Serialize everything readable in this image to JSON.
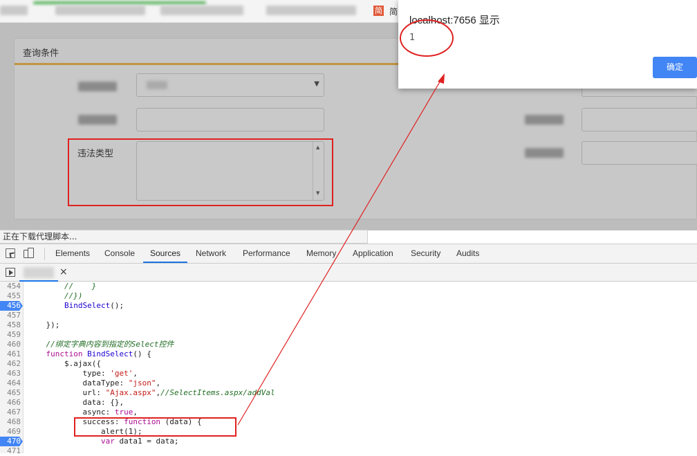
{
  "browser": {
    "bookmark_label": "简"
  },
  "form": {
    "panel_title": "查询条件",
    "illegal_type_label": "违法类型"
  },
  "dialog": {
    "title": "localhost:7656 显示",
    "message": "1",
    "ok_label": "确定"
  },
  "status_bar": {
    "text": "正在下载代理脚本..."
  },
  "devtools": {
    "tabs": [
      "Elements",
      "Console",
      "Sources",
      "Network",
      "Performance",
      "Memory",
      "Application",
      "Security",
      "Audits"
    ],
    "active_tab": "Sources",
    "close_symbol": "×"
  },
  "code": {
    "lines": [
      {
        "n": "454",
        "bp": false,
        "text": "        //    }"
      },
      {
        "n": "455",
        "bp": false,
        "text": "        //})"
      },
      {
        "n": "456",
        "bp": true,
        "text": "        BindSelect();"
      },
      {
        "n": "457",
        "bp": false,
        "text": ""
      },
      {
        "n": "458",
        "bp": false,
        "text": "    });"
      },
      {
        "n": "459",
        "bp": false,
        "text": ""
      },
      {
        "n": "460",
        "bp": false,
        "text": "    //绑定字典内容到指定的Select控件"
      },
      {
        "n": "461",
        "bp": false,
        "text": "    function BindSelect() {"
      },
      {
        "n": "462",
        "bp": false,
        "text": "        $.ajax({"
      },
      {
        "n": "463",
        "bp": false,
        "text": "            type: 'get',"
      },
      {
        "n": "464",
        "bp": false,
        "text": "            dataType: \"json\","
      },
      {
        "n": "465",
        "bp": false,
        "text": "            url: \"Ajax.aspx\",//SelectItems.aspx/addVal"
      },
      {
        "n": "466",
        "bp": false,
        "text": "            data: {},"
      },
      {
        "n": "467",
        "bp": false,
        "text": "            async: true,"
      },
      {
        "n": "468",
        "bp": false,
        "text": "            success: function (data) {"
      },
      {
        "n": "469",
        "bp": false,
        "text": "                alert(1);"
      },
      {
        "n": "470",
        "bp": true,
        "text": "                var data1 = data;"
      },
      {
        "n": "471",
        "bp": false,
        "text": ""
      }
    ]
  },
  "colors": {
    "accent": "#4285f4",
    "annotation_red": "#e02020",
    "panel_underline": "#c29540"
  }
}
